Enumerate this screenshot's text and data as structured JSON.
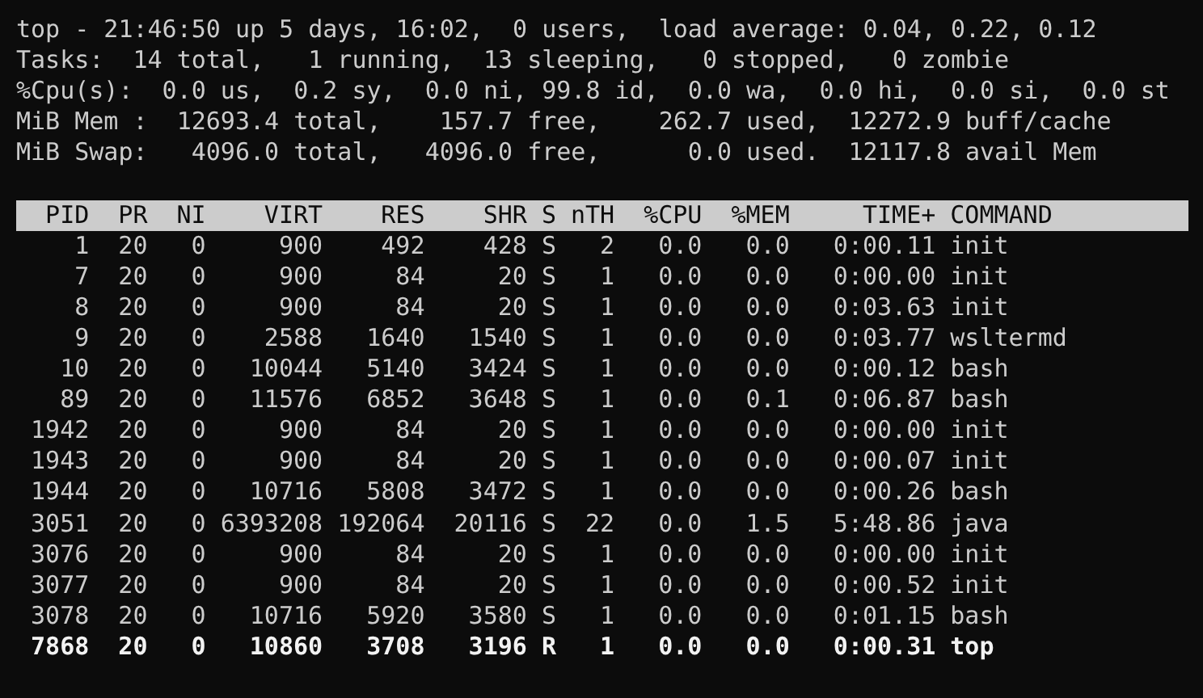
{
  "summary": [
    "top - 21:46:50 up 5 days, 16:02,  0 users,  load average: 0.04, 0.22, 0.12",
    "Tasks:  14 total,   1 running,  13 sleeping,   0 stopped,   0 zombie",
    "%Cpu(s):  0.0 us,  0.2 sy,  0.0 ni, 99.8 id,  0.0 wa,  0.0 hi,  0.0 si,  0.0 st",
    "MiB Mem :  12693.4 total,    157.7 free,    262.7 used,  12272.9 buff/cache",
    "MiB Swap:   4096.0 total,   4096.0 free,      0.0 used.  12117.8 avail Mem"
  ],
  "table": {
    "columns": [
      "PID",
      "PR",
      "NI",
      "VIRT",
      "RES",
      "SHR",
      "S",
      "nTH",
      "%CPU",
      "%MEM",
      "TIME+",
      "COMMAND"
    ],
    "rows": [
      {
        "cells": [
          "1",
          "20",
          "0",
          "900",
          "492",
          "428",
          "S",
          "2",
          "0.0",
          "0.0",
          "0:00.11",
          "init"
        ],
        "highlighted": false
      },
      {
        "cells": [
          "7",
          "20",
          "0",
          "900",
          "84",
          "20",
          "S",
          "1",
          "0.0",
          "0.0",
          "0:00.00",
          "init"
        ],
        "highlighted": false
      },
      {
        "cells": [
          "8",
          "20",
          "0",
          "900",
          "84",
          "20",
          "S",
          "1",
          "0.0",
          "0.0",
          "0:03.63",
          "init"
        ],
        "highlighted": false
      },
      {
        "cells": [
          "9",
          "20",
          "0",
          "2588",
          "1640",
          "1540",
          "S",
          "1",
          "0.0",
          "0.0",
          "0:03.77",
          "wsltermd"
        ],
        "highlighted": false
      },
      {
        "cells": [
          "10",
          "20",
          "0",
          "10044",
          "5140",
          "3424",
          "S",
          "1",
          "0.0",
          "0.0",
          "0:00.12",
          "bash"
        ],
        "highlighted": false
      },
      {
        "cells": [
          "89",
          "20",
          "0",
          "11576",
          "6852",
          "3648",
          "S",
          "1",
          "0.0",
          "0.1",
          "0:06.87",
          "bash"
        ],
        "highlighted": false
      },
      {
        "cells": [
          "1942",
          "20",
          "0",
          "900",
          "84",
          "20",
          "S",
          "1",
          "0.0",
          "0.0",
          "0:00.00",
          "init"
        ],
        "highlighted": false
      },
      {
        "cells": [
          "1943",
          "20",
          "0",
          "900",
          "84",
          "20",
          "S",
          "1",
          "0.0",
          "0.0",
          "0:00.07",
          "init"
        ],
        "highlighted": false
      },
      {
        "cells": [
          "1944",
          "20",
          "0",
          "10716",
          "5808",
          "3472",
          "S",
          "1",
          "0.0",
          "0.0",
          "0:00.26",
          "bash"
        ],
        "highlighted": false
      },
      {
        "cells": [
          "3051",
          "20",
          "0",
          "6393208",
          "192064",
          "20116",
          "S",
          "22",
          "0.0",
          "1.5",
          "5:48.86",
          "java"
        ],
        "highlighted": false
      },
      {
        "cells": [
          "3076",
          "20",
          "0",
          "900",
          "84",
          "20",
          "S",
          "1",
          "0.0",
          "0.0",
          "0:00.00",
          "init"
        ],
        "highlighted": false
      },
      {
        "cells": [
          "3077",
          "20",
          "0",
          "900",
          "84",
          "20",
          "S",
          "1",
          "0.0",
          "0.0",
          "0:00.52",
          "init"
        ],
        "highlighted": false
      },
      {
        "cells": [
          "3078",
          "20",
          "0",
          "10716",
          "5920",
          "3580",
          "S",
          "1",
          "0.0",
          "0.0",
          "0:01.15",
          "bash"
        ],
        "highlighted": false
      },
      {
        "cells": [
          "7868",
          "20",
          "0",
          "10860",
          "3708",
          "3196",
          "R",
          "1",
          "0.0",
          "0.0",
          "0:00.31",
          "top"
        ],
        "highlighted": true
      }
    ]
  }
}
